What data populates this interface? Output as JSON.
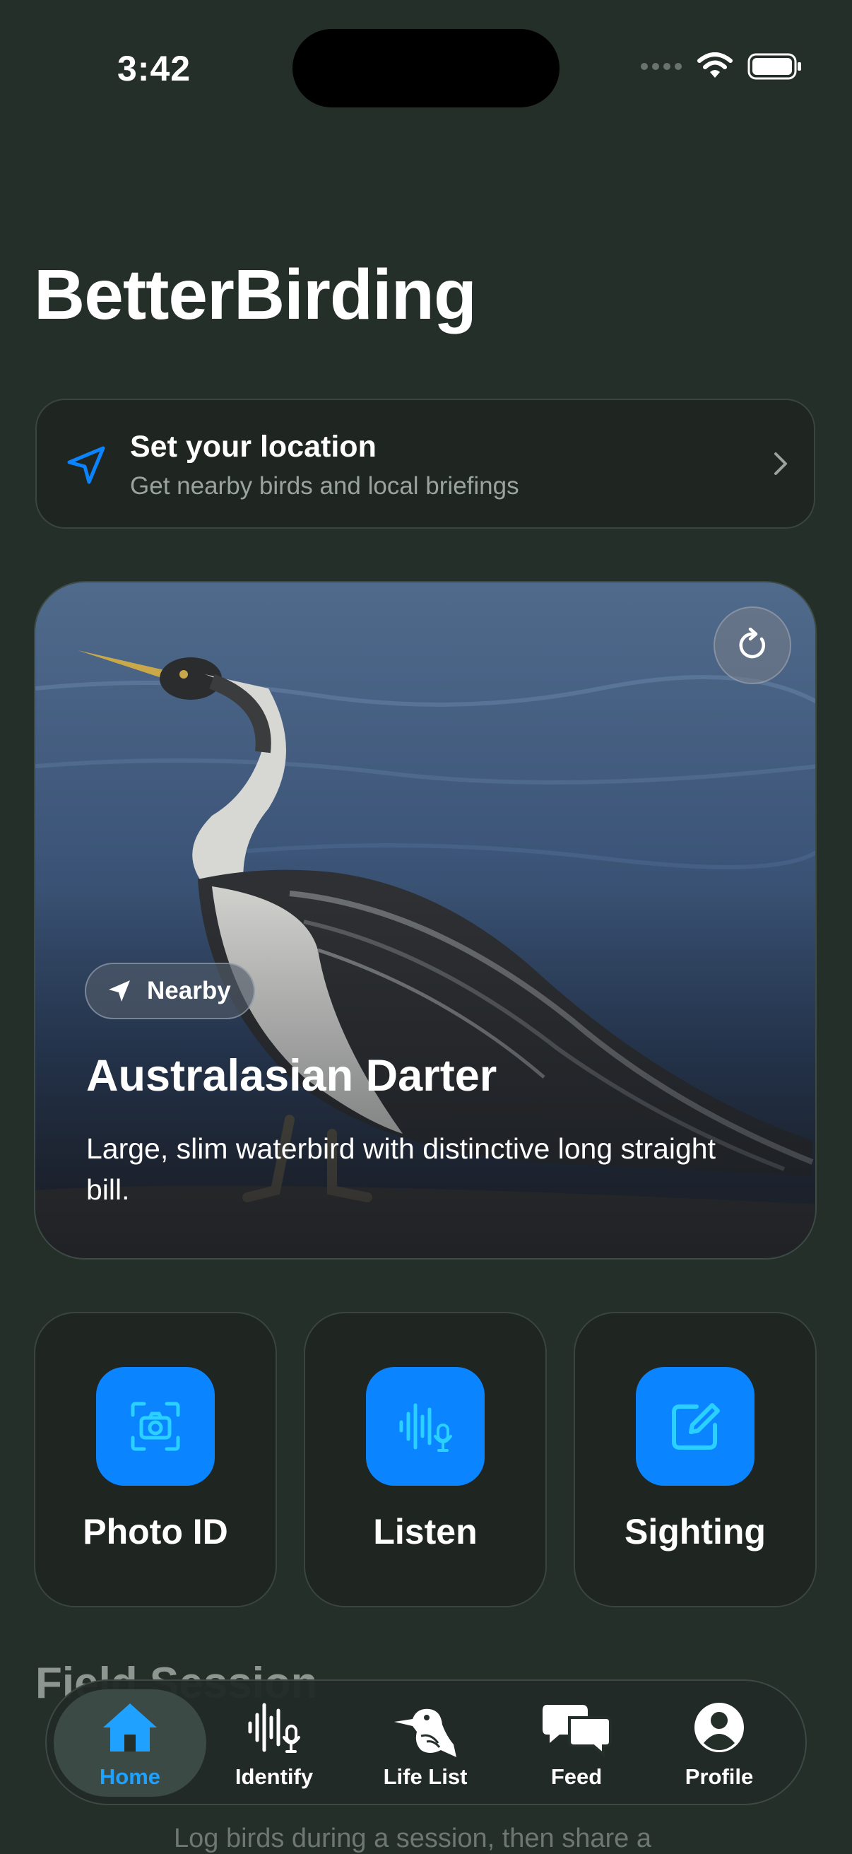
{
  "status_bar": {
    "time": "3:42"
  },
  "app": {
    "title": "BetterBirding"
  },
  "location_card": {
    "title": "Set your location",
    "subtitle": "Get nearby birds and local briefings",
    "icon": "location-arrow-icon"
  },
  "featured": {
    "chip_label": "Nearby",
    "bird_name": "Australasian Darter",
    "description": "Large, slim waterbird with distinctive long straight bill."
  },
  "actions": [
    {
      "label": "Photo ID",
      "icon": "camera-scan-icon"
    },
    {
      "label": "Listen",
      "icon": "waveform-mic-icon"
    },
    {
      "label": "Sighting",
      "icon": "edit-square-icon"
    }
  ],
  "peek": {
    "section_title": "Field Session",
    "body": "Log birds during a session, then share a"
  },
  "tabs": [
    {
      "label": "Home",
      "icon": "house-icon",
      "active": true
    },
    {
      "label": "Identify",
      "icon": "waveform-mic-icon",
      "active": false
    },
    {
      "label": "Life List",
      "icon": "kookaburra-icon",
      "active": false
    },
    {
      "label": "Feed",
      "icon": "chat-bubbles-icon",
      "active": false
    },
    {
      "label": "Profile",
      "icon": "person-circle-icon",
      "active": false
    }
  ],
  "colors": {
    "background": "#252f2a",
    "accent": "#0a84ff",
    "active_tab": "#1fa2ff"
  }
}
